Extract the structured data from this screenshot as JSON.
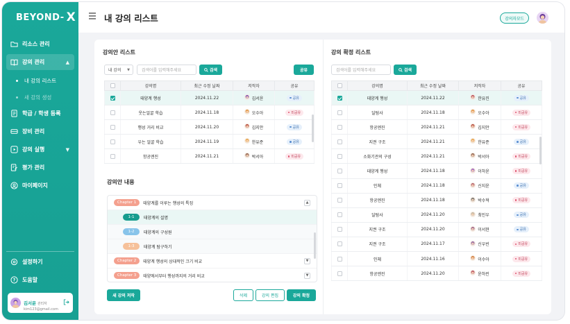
{
  "brand": {
    "logo_text": "BEYOND-",
    "logo_mark": "X"
  },
  "sidebar": {
    "items": [
      {
        "label": "리소스 관리",
        "icon": "folder-icon"
      },
      {
        "label": "강의 관리",
        "icon": "book-icon",
        "active": true
      },
      {
        "label": "학급 / 학생 등록",
        "icon": "document-icon"
      },
      {
        "label": "장비 관리",
        "icon": "car-icon"
      },
      {
        "label": "강의 실행",
        "icon": "play-icon"
      },
      {
        "label": "평가 관리",
        "icon": "edit-doc-icon"
      },
      {
        "label": "마이페이지",
        "icon": "user-icon"
      }
    ],
    "sub_items": [
      {
        "label": "내 강의 리스트",
        "active": true
      },
      {
        "label": "새 강의 생성",
        "active": false
      }
    ],
    "bottom_items": [
      {
        "label": "설정하기",
        "icon": "settings-icon"
      },
      {
        "label": "도움말",
        "icon": "help-icon"
      }
    ],
    "user": {
      "name": "김서윤",
      "role": "관리자",
      "email": "kim123@gmail.com"
    }
  },
  "header": {
    "title": "내 강의 리스트",
    "mode_button": "강의자모드"
  },
  "draft_list": {
    "title": "강의안 리스트",
    "filter_value": "내 강의",
    "search_placeholder": "검색어를 입력해주세요",
    "search_button": "검색",
    "share_button": "공유",
    "columns": [
      "강의명",
      "최근 수정 날짜",
      "저작자",
      "공유"
    ],
    "rows": [
      {
        "checked": true,
        "name": "태양계 행성",
        "date": "2024.11.22",
        "author": "김서윤",
        "status": "공유",
        "shared": true,
        "avatar_color": "#7a4bb3"
      },
      {
        "checked": false,
        "name": "웃는얼굴 학습",
        "date": "2024.11.18",
        "author": "오수아",
        "status": "미공유",
        "shared": false,
        "avatar_color": "#e0913a"
      },
      {
        "checked": false,
        "name": "행성 거리 비교",
        "date": "2024.11.20",
        "author": "김지안",
        "status": "공유",
        "shared": true,
        "avatar_color": "#b2443a"
      },
      {
        "checked": false,
        "name": "우는 얼굴 학습",
        "date": "2024.11.19",
        "author": "한유준",
        "status": "공유",
        "shared": true,
        "avatar_color": "#e8a346"
      },
      {
        "checked": false,
        "name": "항공엔진",
        "date": "2024.11.21",
        "author": "박서아",
        "status": "미공유",
        "shared": false,
        "avatar_color": "#8a5c4a"
      }
    ]
  },
  "content": {
    "title": "강의안 내용",
    "chapters": [
      {
        "tag": "Chapter 1",
        "label": "태양계를 이루는 행성의 특징",
        "expanded": true,
        "subs": [
          {
            "tag": "1-1",
            "label": "태양계의 설명"
          },
          {
            "tag": "1-2",
            "label": "태양계의 구성원"
          },
          {
            "tag": "1-3",
            "label": "태양계 탐구하기"
          }
        ]
      },
      {
        "tag": "Chapter 2",
        "label": "태양계 행성의 상대적인 크기 비교",
        "expanded": false
      },
      {
        "tag": "Chapter 3",
        "label": "태양에서부터 행성까지의 거리 비교",
        "expanded": false
      }
    ],
    "new_button": "새 강의 저작",
    "delete_button": "삭제",
    "edit_button": "강의 편집",
    "confirm_button": "강의 확정"
  },
  "confirmed_list": {
    "title": "강의 확정 리스트",
    "search_placeholder": "검색어를 입력해주세요",
    "search_button": "검색",
    "columns": [
      "강의명",
      "최근 수정 날짜",
      "저작자",
      "공유"
    ],
    "rows": [
      {
        "checked": true,
        "name": "태양계 행성",
        "date": "2024.11.22",
        "author": "한유진",
        "status": "공유",
        "shared": true,
        "avatar_color": "#b24a5a"
      },
      {
        "checked": false,
        "name": "달탐사",
        "date": "2024.11.18",
        "author": "오수아",
        "status": "미공유",
        "shared": false,
        "avatar_color": "#e0913a"
      },
      {
        "checked": false,
        "name": "항공엔진",
        "date": "2024.11.21",
        "author": "김지안",
        "status": "미공유",
        "shared": false,
        "avatar_color": "#b2443a"
      },
      {
        "checked": false,
        "name": "지권 구조",
        "date": "2024.11.21",
        "author": "한유준",
        "status": "공유",
        "shared": true,
        "avatar_color": "#e8a346"
      },
      {
        "checked": false,
        "name": "소화기관의 구성",
        "date": "2024.11.21",
        "author": "박서아",
        "status": "미공유",
        "shared": false,
        "avatar_color": "#8a5c4a"
      },
      {
        "checked": false,
        "name": "태양계 행성",
        "date": "2024.11.18",
        "author": "이하윤",
        "status": "미공유",
        "shared": false,
        "avatar_color": "#9a5cc0"
      },
      {
        "checked": false,
        "name": "인체",
        "date": "2024.11.18",
        "author": "신지윤",
        "status": "공유",
        "shared": true,
        "avatar_color": "#b35a6a"
      },
      {
        "checked": false,
        "name": "항공엔진",
        "date": "2024.11.18",
        "author": "박수혁",
        "status": "미공유",
        "shared": false,
        "avatar_color": "#6a6a6a"
      },
      {
        "checked": false,
        "name": "달탐사",
        "date": "2024.11.20",
        "author": "최민우",
        "status": "공유",
        "shared": true,
        "avatar_color": "#c0b4a0"
      },
      {
        "checked": false,
        "name": "지권 구조",
        "date": "2024.11.20",
        "author": "이서현",
        "status": "공유",
        "shared": true,
        "avatar_color": "#9a5c8a"
      },
      {
        "checked": false,
        "name": "지권 구조",
        "date": "2024.11.17",
        "author": "신우빈",
        "status": "미공유",
        "shared": false,
        "avatar_color": "#8a5ca0"
      },
      {
        "checked": false,
        "name": "인체",
        "date": "2024.11.16",
        "author": "이수아",
        "status": "미공유",
        "shared": false,
        "avatar_color": "#d07a3a"
      },
      {
        "checked": false,
        "name": "항공엔진",
        "date": "2024.11.20",
        "author": "윤하린",
        "status": "미공유",
        "shared": false,
        "avatar_color": "#b5475a"
      }
    ]
  }
}
